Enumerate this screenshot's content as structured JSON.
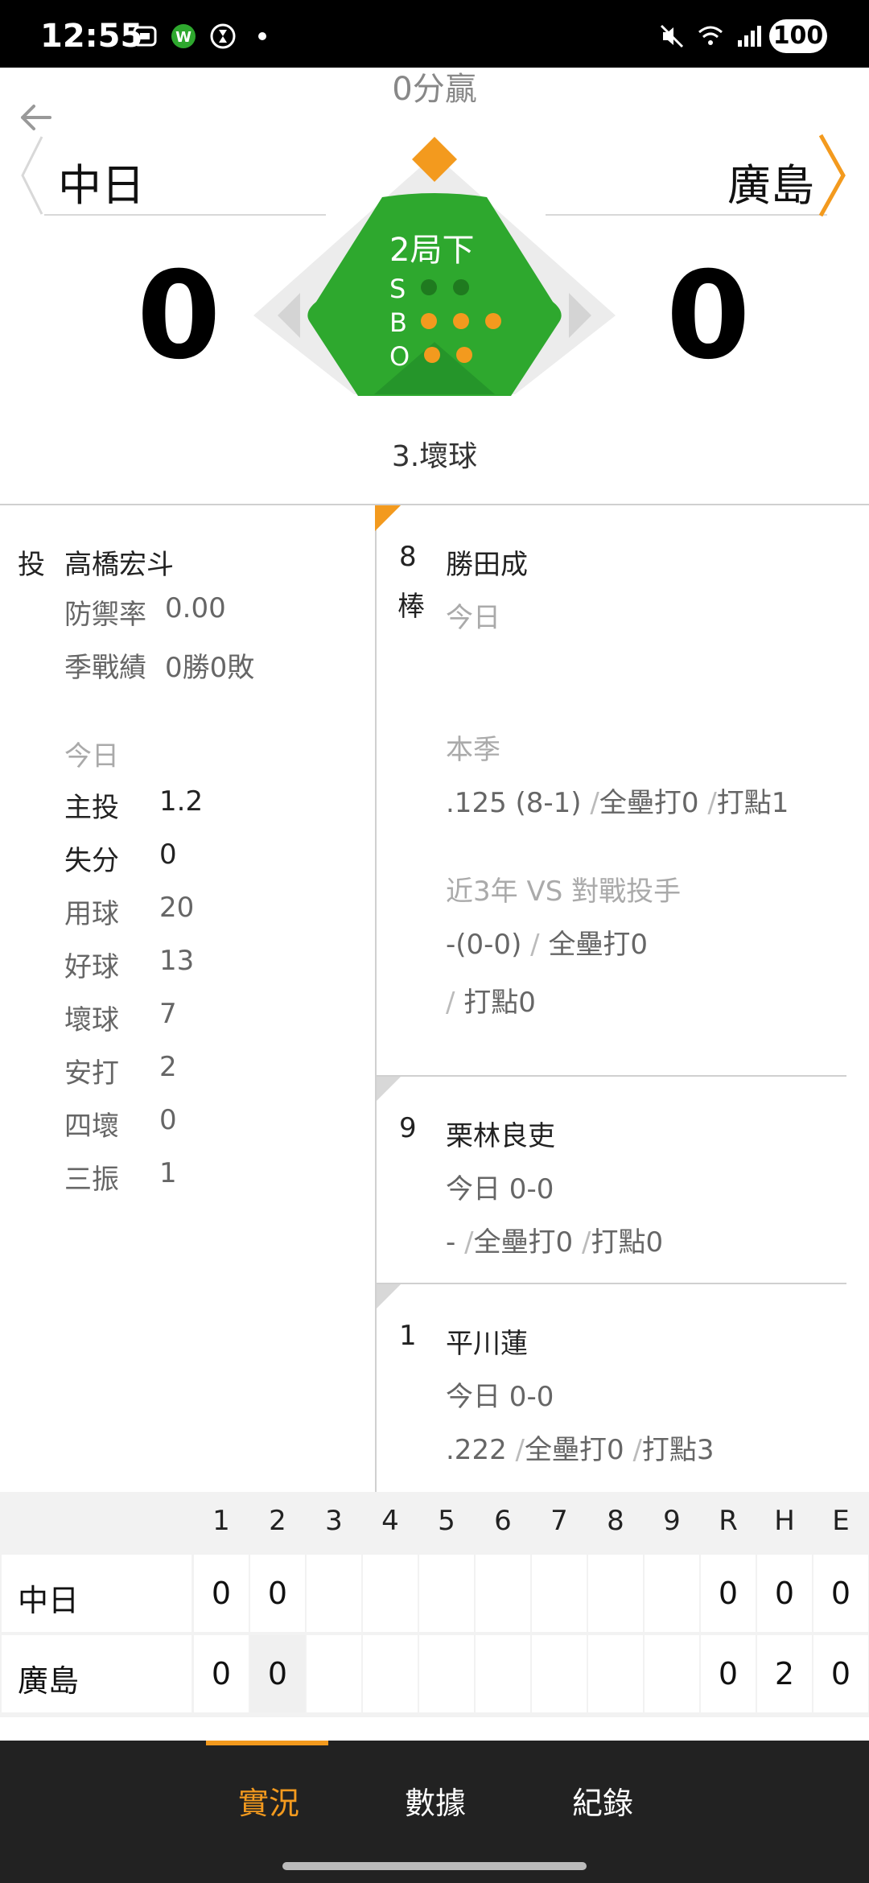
{
  "status_bar": {
    "time": "12:55",
    "battery": "100"
  },
  "game": {
    "status_top": "0分贏",
    "away_team": "中日",
    "home_team": "廣島",
    "away_score": "0",
    "home_score": "0",
    "inning": "2局下",
    "count_labels": {
      "s": "S",
      "b": "B",
      "o": "O"
    },
    "strikes": 0,
    "balls": 3,
    "outs": 2,
    "last_play": "3.壞球",
    "colors": {
      "field": "#2ea82e",
      "accent": "#f39a1e",
      "ball_on": "#f39a1e",
      "ball_off": "#1f7a1f"
    }
  },
  "pitcher": {
    "role": "投",
    "name": "高橋宏斗",
    "era_label": "防禦率",
    "era": "0.00",
    "record_label": "季戰績",
    "record": "0勝0敗",
    "today_label": "今日",
    "stats": [
      {
        "label": "主投",
        "value": "1.2"
      },
      {
        "label": "失分",
        "value": "0"
      },
      {
        "label": "用球",
        "value": "20"
      },
      {
        "label": "好球",
        "value": "13"
      },
      {
        "label": "壞球",
        "value": "7"
      },
      {
        "label": "安打",
        "value": "2"
      },
      {
        "label": "四壞",
        "value": "0"
      },
      {
        "label": "三振",
        "value": "1"
      }
    ]
  },
  "current_batter": {
    "order": "8",
    "at_bat": "棒",
    "name": "勝田成",
    "today_label": "今日",
    "season_label": "本季",
    "season_avg": ".125 (8-1)",
    "season_hr": "全壘打0",
    "season_rbi": "打點1",
    "vs_label": "近3年 VS 對戰投手",
    "vs_avg": "-(0-0)",
    "vs_hr": "全壘打0",
    "vs_rbi": "打點0",
    "separator": "/"
  },
  "next_batters": [
    {
      "order": "9",
      "name": "栗林良吏",
      "today": "今日 0-0",
      "avg": "-",
      "hr": "全壘打0",
      "rbi": "打點0"
    },
    {
      "order": "1",
      "name": "平川蓮",
      "today": "今日 0-0",
      "avg": ".222",
      "hr": "全壘打0",
      "rbi": "打點3"
    }
  ],
  "scoreboard": {
    "headers": [
      "1",
      "2",
      "3",
      "4",
      "5",
      "6",
      "7",
      "8",
      "9",
      "R",
      "H",
      "E"
    ],
    "rows": [
      {
        "team": "中日",
        "cells": [
          "0",
          "0",
          "",
          "",
          "",
          "",
          "",
          "",
          "",
          "0",
          "0",
          "0"
        ]
      },
      {
        "team": "廣島",
        "cells": [
          "0",
          "0",
          "",
          "",
          "",
          "",
          "",
          "",
          "",
          "0",
          "2",
          "0"
        ]
      }
    ]
  },
  "bottom_nav": {
    "tabs": [
      "實況",
      "數據",
      "紀錄"
    ],
    "active": 0
  }
}
